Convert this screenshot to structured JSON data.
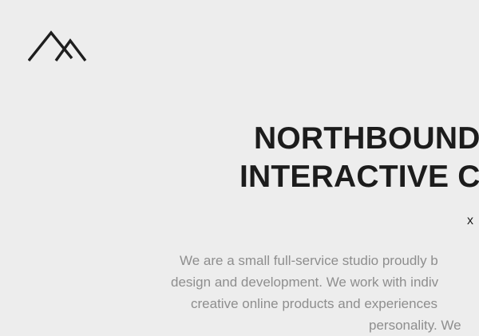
{
  "brand": {
    "logo_icon": "mountain-peaks-icon"
  },
  "hero": {
    "headline_line1": "NORTHBOUND",
    "headline_line2": "INTERACTIVE CR",
    "close_label": "x"
  },
  "intro": {
    "line1": "We are a small full-service studio proudly b",
    "line2": "design and development. We work with indiv",
    "line3": "creative online products and experiences",
    "line4": "personality. We"
  },
  "colors": {
    "background": "#ededed",
    "headline": "#1c1c1c",
    "body_text": "#8e8e8e"
  }
}
